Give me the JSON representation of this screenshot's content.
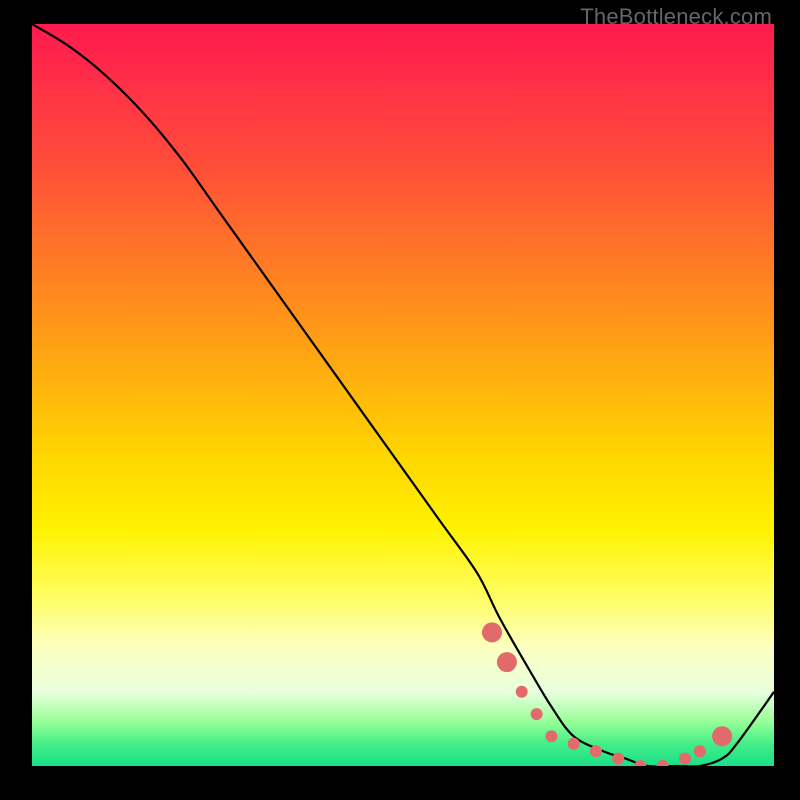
{
  "attribution": "TheBottleneck.com",
  "chart_data": {
    "type": "line",
    "title": "",
    "xlabel": "",
    "ylabel": "",
    "xlim": [
      0,
      100
    ],
    "ylim": [
      0,
      100
    ],
    "series": [
      {
        "name": "bottleneck-curve",
        "x": [
          0,
          5,
          10,
          15,
          20,
          25,
          30,
          35,
          40,
          45,
          50,
          55,
          60,
          63,
          67,
          70,
          73,
          77,
          80,
          83,
          87,
          90,
          93,
          95,
          100
        ],
        "values": [
          100,
          97,
          93,
          88,
          82,
          75,
          68,
          61,
          54,
          47,
          40,
          33,
          26,
          20,
          13,
          8,
          4,
          2,
          1,
          0,
          0,
          0,
          1,
          3,
          10
        ]
      }
    ],
    "markers": {
      "name": "cluster-dots",
      "x": [
        62,
        64,
        66,
        68,
        70,
        73,
        76,
        79,
        82,
        85,
        88,
        90,
        93
      ],
      "values": [
        18,
        14,
        10,
        7,
        4,
        3,
        2,
        1,
        0,
        0,
        1,
        2,
        4
      ],
      "color": "#e26a6a",
      "size_small": 6,
      "size_large": 10
    },
    "gradient_stops": [
      {
        "pos": 0.0,
        "color": "#ff1a4d"
      },
      {
        "pos": 0.18,
        "color": "#ff4a3a"
      },
      {
        "pos": 0.46,
        "color": "#ffaa10"
      },
      {
        "pos": 0.68,
        "color": "#fff200"
      },
      {
        "pos": 0.9,
        "color": "#e8ffde"
      },
      {
        "pos": 1.0,
        "color": "#1adf89"
      }
    ]
  }
}
